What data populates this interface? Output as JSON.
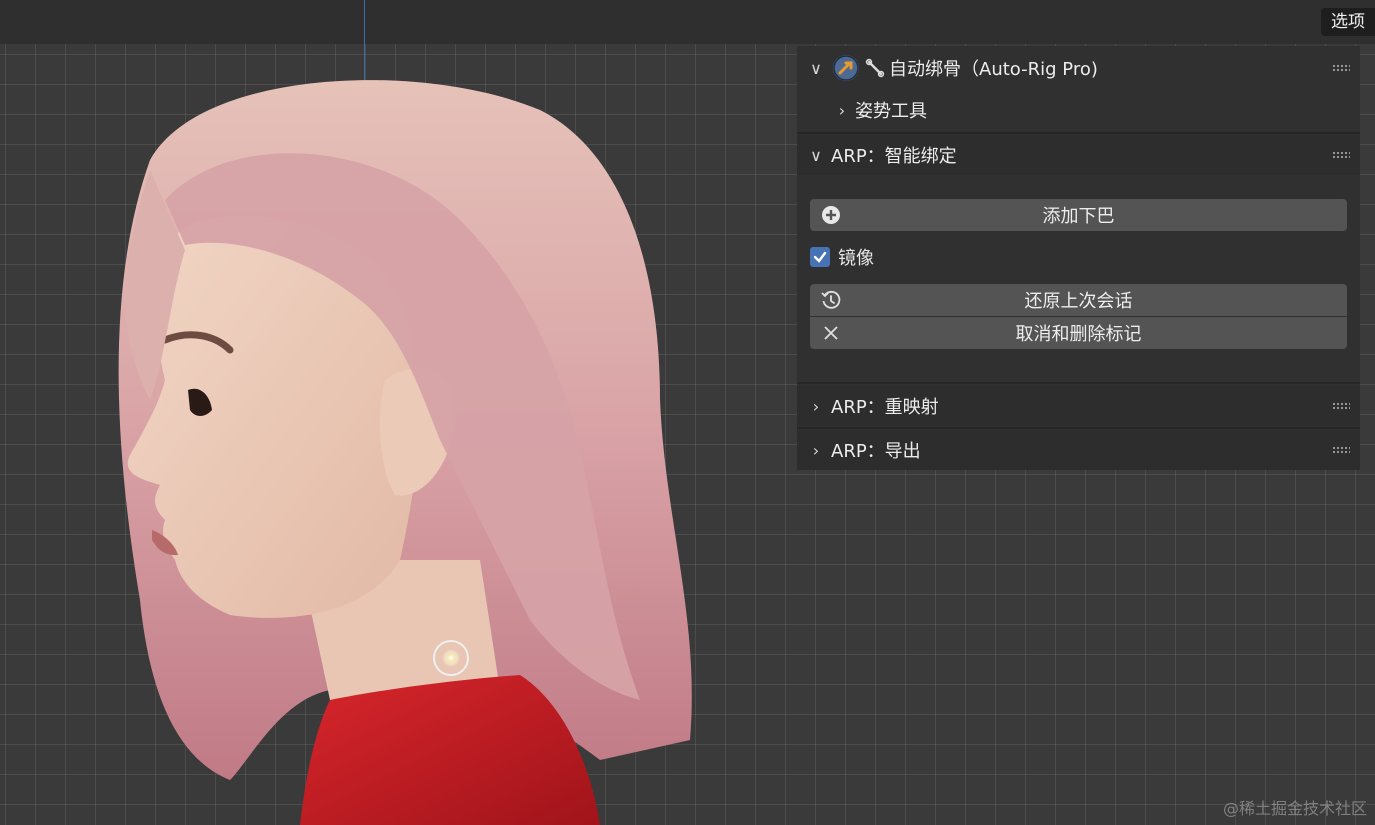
{
  "options_tab": "选项",
  "panel": {
    "addon_header": {
      "title": "自动绑骨（Auto-Rig Pro)",
      "expanded": true,
      "sub_item": "姿势工具"
    },
    "smart_section": {
      "title": "ARP：智能绑定",
      "expanded": true,
      "add_chin_button": "添加下巴",
      "mirror_label": "镜像",
      "mirror_checked": true,
      "restore_button": "还原上次会话",
      "cancel_button": "取消和删除标记"
    },
    "remap_section": {
      "title": "ARP：重映射",
      "expanded": false
    },
    "export_section": {
      "title": "ARP：导出",
      "expanded": false
    }
  },
  "watermark": "@稀土掘金技术社区",
  "colors": {
    "accent_blue": "#4772b3",
    "panel_bg": "#303030",
    "button_bg": "#545454",
    "hair": "#d49aa0",
    "shirt": "#c01e24"
  }
}
